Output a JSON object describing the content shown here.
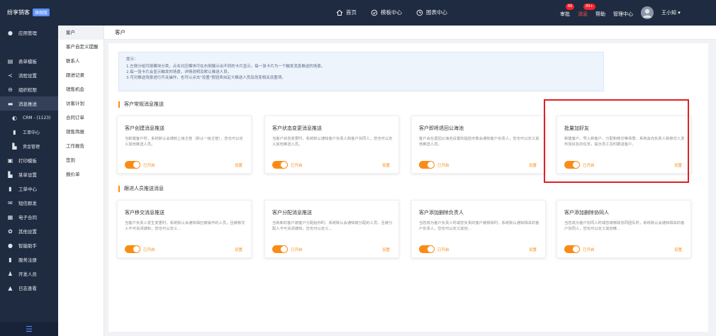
{
  "topbar": {
    "app_name": "纷享销客",
    "app_badge": "旗舰版",
    "nav": [
      {
        "label": "首页",
        "icon": "home-icon"
      },
      {
        "label": "模板中心",
        "icon": "template-icon"
      },
      {
        "label": "图表中心",
        "icon": "chart-icon"
      }
    ],
    "right": {
      "approval_label": "审批",
      "approval_count": "66",
      "alarm_label": "消息",
      "alarm_count": "99+",
      "help_label": "帮助",
      "admin_label": "管理中心",
      "user_name": "王小知"
    }
  },
  "sidebar": {
    "items": [
      {
        "label": "应用管理",
        "icon": "app-icon"
      },
      {
        "label": "表单模板",
        "icon": "form-icon"
      },
      {
        "label": "流程设置",
        "icon": "flow-icon"
      },
      {
        "label": "组织权限",
        "icon": "org-icon"
      },
      {
        "label": "消息推送",
        "icon": "message-icon"
      },
      {
        "label": "CRM - (1123)",
        "icon": "crm-icon"
      },
      {
        "label": "工单中心",
        "icon": "ticket-icon"
      },
      {
        "label": "资金管理",
        "icon": "fund-icon"
      },
      {
        "label": "打印模板",
        "icon": "print-icon"
      },
      {
        "label": "某单设置",
        "icon": "order-icon"
      },
      {
        "label": "工单中心",
        "icon": "ticket2-icon"
      },
      {
        "label": "短信群发",
        "icon": "sms-icon"
      },
      {
        "label": "电子合同",
        "icon": "contract-icon"
      },
      {
        "label": "其他设置",
        "icon": "settings-icon"
      },
      {
        "label": "智能助手",
        "icon": "assistant-icon"
      },
      {
        "label": "服务注册",
        "icon": "service-icon"
      },
      {
        "label": "开发人员",
        "icon": "developer-icon"
      },
      {
        "label": "日志查看",
        "icon": "log-icon"
      }
    ]
  },
  "subnav": {
    "items": [
      "客户",
      "客户自定义提醒",
      "联系人",
      "跟进记录",
      "销售机会",
      "访客计划",
      "合同订单",
      "销售简报",
      "工作报告",
      "签到",
      "报价单"
    ]
  },
  "main": {
    "header_title": "客户",
    "tip": {
      "title": "提示：",
      "lines": [
        "1.左侧分组可按模块分类，点击对应模块可在右侧展示出不同的卡片显示，每一张卡片为一个触发消息推送的场景。",
        "2.每一张卡片会显示触发的场景，详情说明及默认推送人员。",
        "3.可对推送场景进行开关操作，也可以点击\"设置\"按钮来自定义推送人员及改变相关设置项。"
      ]
    },
    "sections": [
      {
        "title": "客户常规消息推送",
        "cards": [
          {
            "title": "客户创建消息推送",
            "desc": "当新建客户时，系统默认会通知上级主管（默认一级主管），您也可以定义其他推送人员。",
            "status": "已开启",
            "setting": "设置"
          },
          {
            "title": "客户状态变更消息推送",
            "desc": "当客户状态变更时，系统默认通知客户负责人和客户协同人，您也可以定义其他推送人员。",
            "status": "已开启",
            "setting": "设置"
          },
          {
            "title": "客户即将退回公海池",
            "desc": "客户会在退回公海池设置的提前天数会通知客户负责人，您也可以定义其他推送人员。",
            "status": "已开启",
            "setting": "设置"
          },
          {
            "title": "批量加好友",
            "desc": "新建客户、导入新客户、分配和移交等场景，系统会向负责人和移交人发布加好友的任务，提示员工及时跟进客户。",
            "status": "已开启",
            "setting": "设置"
          }
        ]
      },
      {
        "title": "跟进人员推送消息",
        "cards": [
          {
            "title": "客户移交消息推送",
            "desc": "当客户负责人发生变更时，系统默认会通知相应被操作的人员，且被移交人不可关闭通知，您也可以定义...",
            "status": "已开启",
            "setting": "设置"
          },
          {
            "title": "客户分配消息推送",
            "desc": "当有新的客户被客户分配给你时，系统默认会通知被分配的人员，且被分配人不可关闭通知，您也可以定义...",
            "status": "已开启",
            "setting": "设置"
          },
          {
            "title": "客户添加删除负责人",
            "desc": "当您成为客户负责人时或您负责的客户被移除时，系统默认通知相关的客户负责人，您也可以定义其他...",
            "status": "已开启",
            "setting": "设置"
          },
          {
            "title": "客户添加删除协同人",
            "desc": "当您成为客户协同人时或您被移除协同团队时，系统默认会通知相关的客户协同人，您也可以定义其他推...",
            "status": "已开启",
            "setting": "设置"
          }
        ]
      }
    ]
  }
}
